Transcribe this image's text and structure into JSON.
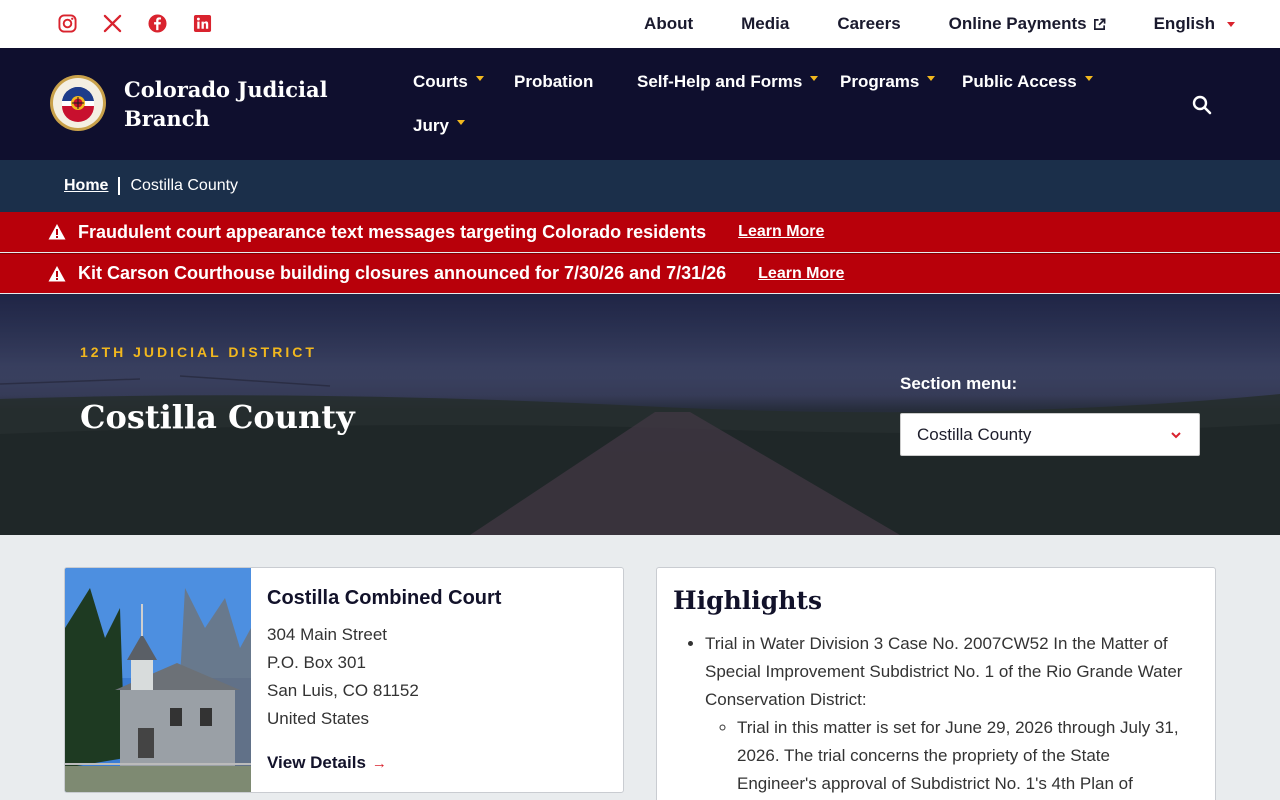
{
  "utility": {
    "social": [
      {
        "name": "instagram-icon"
      },
      {
        "name": "x-icon"
      },
      {
        "name": "facebook-icon"
      },
      {
        "name": "linkedin-icon"
      }
    ],
    "links": {
      "about": "About",
      "media": "Media",
      "careers": "Careers",
      "payments": "Online Payments",
      "language": "English"
    },
    "accent_color": "#d9232e"
  },
  "header": {
    "title": "Colorado Judicial Branch",
    "seal_text": "COLORADO COURTS",
    "nav": {
      "courts": "Courts",
      "probation": "Probation",
      "self_help": "Self-Help and Forms",
      "programs": "Programs",
      "public_access": "Public Access",
      "jury": "Jury"
    },
    "bg_color": "#0f0f2e",
    "accent_color": "#f2b81e"
  },
  "breadcrumb": {
    "home": "Home",
    "current": "Costilla County"
  },
  "alerts": [
    {
      "message": "Fraudulent court appearance text messages targeting Colorado residents",
      "link": "Learn More"
    },
    {
      "message": "Kit Carson Courthouse building closures announced for 7/30/26 and 7/31/26",
      "link": "Learn More"
    }
  ],
  "hero": {
    "kicker": "12TH JUDICIAL DISTRICT",
    "title": "Costilla County",
    "section_menu_label": "Section menu:",
    "section_menu_value": "Costilla County"
  },
  "court": {
    "name": "Costilla Combined Court",
    "address": [
      "304 Main Street",
      "P.O. Box 301",
      "San Luis, CO 81152",
      "United States"
    ],
    "link": "View Details"
  },
  "highlights": {
    "title": "Highlights",
    "item1": "Trial in Water Division 3 Case No. 2007CW52 In the Matter of Special Improvement Subdistrict No. 1 of the Rio Grande Water Conservation District:",
    "sub1": "Trial in this matter is set for June 29, 2026 through July 31, 2026. The trial concerns the propriety of the State Engineer's approval of Subdistrict No. 1's 4th Plan of"
  }
}
